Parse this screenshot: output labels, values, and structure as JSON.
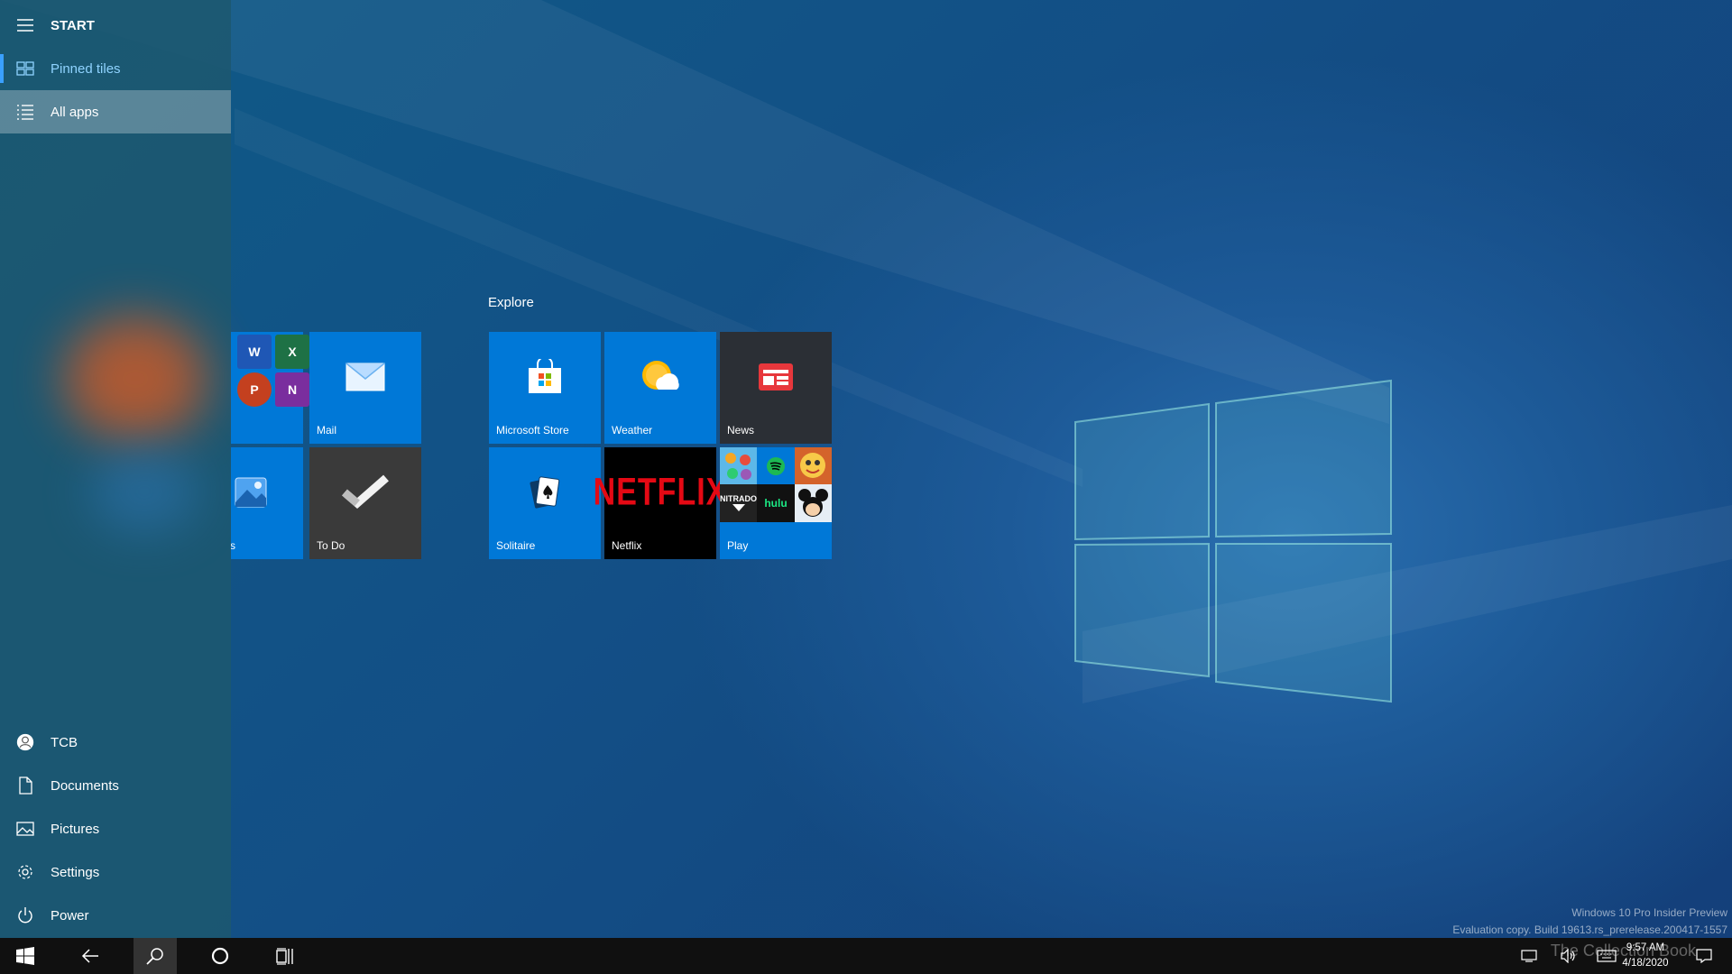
{
  "start_menu": {
    "title": "START",
    "top_items": [
      {
        "label": "Pinned tiles",
        "icon": "tiles-icon",
        "active": true
      },
      {
        "label": "All apps",
        "icon": "list-icon",
        "selected": true
      }
    ],
    "bottom_items": [
      {
        "label": "TCB",
        "icon": "user-avatar-icon"
      },
      {
        "label": "Documents",
        "icon": "document-icon"
      },
      {
        "label": "Pictures",
        "icon": "pictures-icon"
      },
      {
        "label": "Settings",
        "icon": "gear-icon"
      },
      {
        "label": "Power",
        "icon": "power-icon"
      }
    ]
  },
  "tiles": {
    "left_group": [
      {
        "label": "",
        "icon": "office-apps-icon",
        "partial": true
      },
      {
        "label": "Mail",
        "icon": "mail-icon"
      },
      {
        "label": "s",
        "icon": "photos-icon",
        "partial": true
      },
      {
        "label": "To Do",
        "icon": "checkmark-icon"
      }
    ],
    "explore": {
      "title": "Explore",
      "items": [
        {
          "label": "Microsoft Store",
          "icon": "store-bag-icon"
        },
        {
          "label": "Weather",
          "icon": "weather-sun-cloud-icon"
        },
        {
          "label": "News",
          "icon": "news-icon"
        },
        {
          "label": "Solitaire",
          "icon": "cards-icon"
        },
        {
          "label": "Netflix",
          "icon": "netflix-logo",
          "logo_text": "NETFLIX"
        },
        {
          "label": "Play",
          "icon": "games-folder-icon",
          "mini_labels": [
            "NITRADO",
            "hulu"
          ]
        }
      ]
    },
    "office_letters": [
      "W",
      "X",
      "P",
      "N"
    ]
  },
  "watermark": {
    "line1": "Windows 10 Pro Insider Preview",
    "line2": "Evaluation copy. Build 19613.rs_prerelease.200417-1557",
    "brand": "The Collection Book"
  },
  "taskbar": {
    "buttons": [
      "start-icon",
      "back-arrow-icon",
      "search-icon",
      "cortana-icon",
      "task-view-icon"
    ],
    "clock_time": "9:57 AM",
    "clock_date": "4/18/2020"
  },
  "colors": {
    "tile_blue": "#0078d7",
    "tile_dark": "#2b2b2b",
    "netflix_red": "#e50914",
    "sidebar": "#1c5870"
  }
}
